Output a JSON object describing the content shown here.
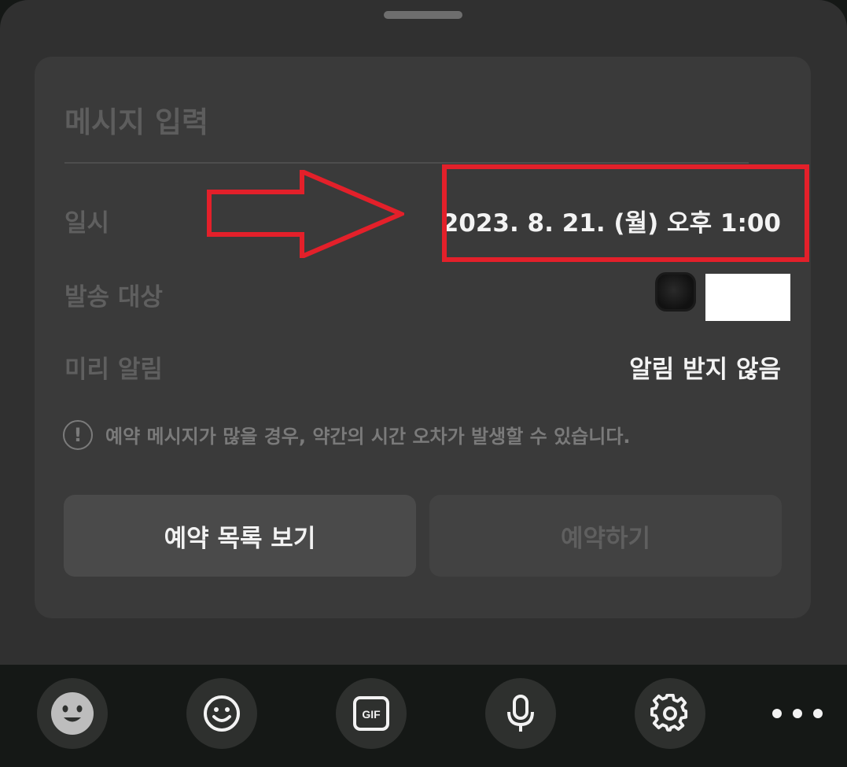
{
  "message": {
    "placeholder": "메시지 입력"
  },
  "rows": {
    "datetime": {
      "label": "일시",
      "value": "2023. 8. 21. (월) 오후 1:00"
    },
    "target": {
      "label": "발송 대상"
    },
    "reminder": {
      "label": "미리 알림",
      "value": "알림 받지 않음"
    }
  },
  "notice": {
    "icon": "!",
    "text": "예약 메시지가 많을 경우, 약간의 시간 오차가 발생할 수 있습니다."
  },
  "buttons": {
    "list_label": "예약 목록 보기",
    "reserve_label": "예약하기"
  },
  "toolbar": {
    "gif_label": "GIF",
    "icons": [
      "emoticon-face-icon",
      "smile-icon",
      "gif-icon",
      "microphone-icon",
      "gear-icon",
      "more-icon"
    ]
  },
  "colors": {
    "highlight": "#e3202a",
    "background": "#303030",
    "card": "#3a3a3a"
  }
}
